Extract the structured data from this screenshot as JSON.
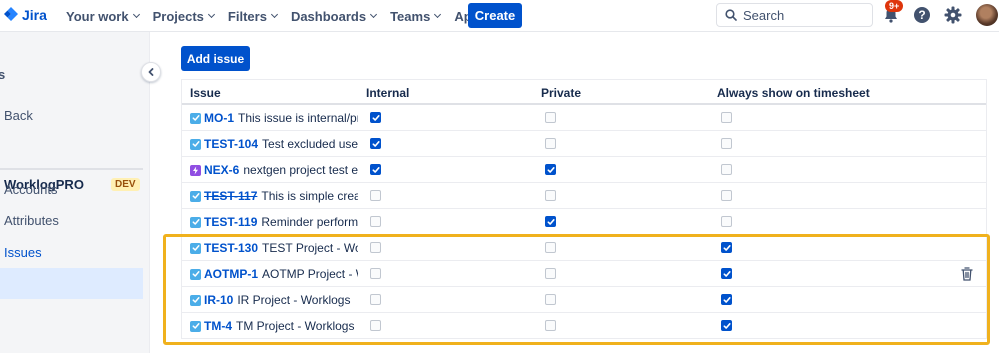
{
  "app": {
    "name": "Jira"
  },
  "nav": {
    "items": [
      "Your work",
      "Projects",
      "Filters",
      "Dashboards",
      "Teams",
      "Apps"
    ],
    "create_label": "Create",
    "search_placeholder": "Search",
    "notifications_badge": "9+"
  },
  "sidebar": {
    "back_label": "Back",
    "project_name": "WorklogPRO",
    "project_badge": "DEV",
    "items": [
      "Accounts",
      "Attributes",
      "Issues"
    ],
    "active_item": "Issues",
    "heading_fragment": "s"
  },
  "main": {
    "add_issue_label": "Add issue",
    "columns": [
      "Issue",
      "Internal",
      "Private",
      "Always show on timesheet"
    ],
    "rows": [
      {
        "type": "task",
        "key": "MO-1",
        "summary": "This issue is internal/private",
        "strike": false,
        "internal": true,
        "private": false,
        "always": false
      },
      {
        "type": "task",
        "key": "TEST-104",
        "summary": "Test excluded users",
        "strike": false,
        "internal": true,
        "private": false,
        "always": false
      },
      {
        "type": "subtask",
        "key": "NEX-6",
        "summary": "nextgen project test epic",
        "strike": false,
        "internal": true,
        "private": true,
        "always": false
      },
      {
        "type": "task",
        "key": "TEST-117",
        "summary": "This is simple created issue",
        "strike": true,
        "internal": false,
        "private": false,
        "always": false
      },
      {
        "type": "task",
        "key": "TEST-119",
        "summary": "Reminder performance test",
        "strike": false,
        "internal": false,
        "private": true,
        "always": false
      },
      {
        "type": "task",
        "key": "TEST-130",
        "summary": "TEST Project - Worklogs",
        "strike": false,
        "internal": false,
        "private": false,
        "always": true
      },
      {
        "type": "task",
        "key": "AOTMP-1",
        "summary": "AOTMP Project - Worklogs",
        "strike": false,
        "internal": false,
        "private": false,
        "always": true
      },
      {
        "type": "task",
        "key": "IR-10",
        "summary": "IR Project - Worklogs",
        "strike": false,
        "internal": false,
        "private": false,
        "always": true
      },
      {
        "type": "task",
        "key": "TM-4",
        "summary": "TM Project - Worklogs",
        "strike": false,
        "internal": false,
        "private": false,
        "always": true
      }
    ],
    "trash_row": "AOTMP-1"
  },
  "colors": {
    "brand": "#0052cc",
    "highlight": "#f0b11d",
    "checked": "#0052cc",
    "task_icon": "#4bade8",
    "subtask_icon": "#904ee2"
  },
  "icons": [
    "jira-logo-icon",
    "chevron-down-icon",
    "search-icon",
    "notifications-icon",
    "help-icon",
    "settings-icon",
    "avatar",
    "collapse-sidebar-icon",
    "task-type-icon",
    "subtask-type-icon",
    "checkbox-check-icon",
    "trash-icon"
  ]
}
